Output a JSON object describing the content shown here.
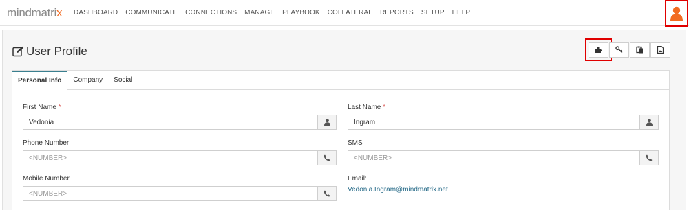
{
  "app": {
    "logo_text_main": "mindmatri",
    "logo_text_accent": "x"
  },
  "nav": {
    "items": [
      "DASHBOARD",
      "COMMUNICATE",
      "CONNECTIONS",
      "MANAGE",
      "PLAYBOOK",
      "COLLATERAL",
      "REPORTS",
      "SETUP",
      "HELP"
    ]
  },
  "page": {
    "title": "User Profile"
  },
  "toolbar": {
    "icons": [
      "puzzle-icon",
      "key-icon",
      "clipboard-icon",
      "image-icon"
    ]
  },
  "tabs": [
    {
      "label": "Personal Info",
      "active": true
    },
    {
      "label": "Company",
      "active": false
    },
    {
      "label": "Social",
      "active": false
    }
  ],
  "form": {
    "first_name": {
      "label": "First Name",
      "required": "*",
      "value": "Vedonia"
    },
    "last_name": {
      "label": "Last Name",
      "required": "*",
      "value": "Ingram"
    },
    "phone": {
      "label": "Phone Number",
      "placeholder": "<NUMBER>"
    },
    "sms": {
      "label": "SMS",
      "placeholder": "<NUMBER>"
    },
    "mobile": {
      "label": "Mobile Number",
      "placeholder": "<NUMBER>"
    },
    "email": {
      "label": "Email:",
      "value": "Vedonia.Ingram@mindmatrix.net"
    }
  },
  "colors": {
    "accent": "#f26b21",
    "highlight": "#e00000",
    "tab_active": "#3a7f8f",
    "link": "#2a6d8a"
  }
}
